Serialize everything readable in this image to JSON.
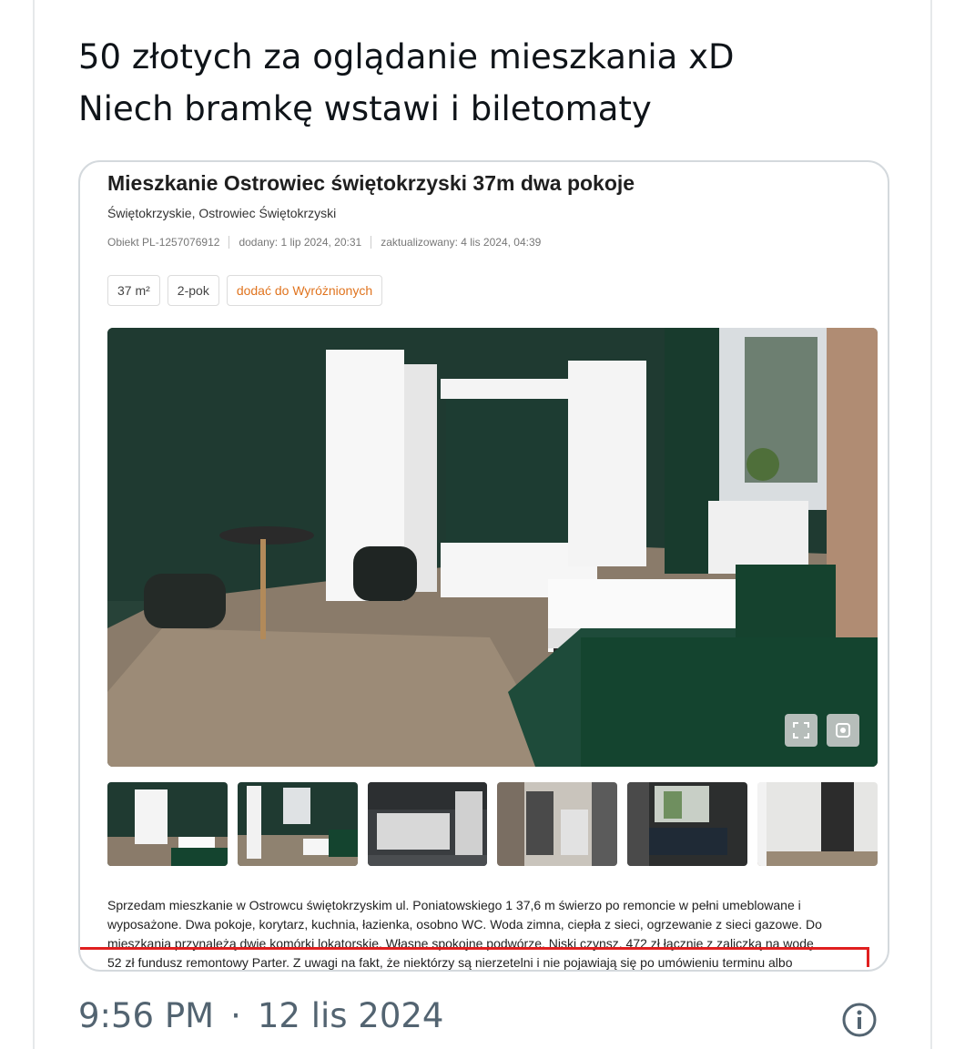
{
  "tweet": {
    "line1": "50 złotych za oglądanie mieszkania xD",
    "line2": "Niech bramkę wstawi i biletomaty"
  },
  "listing": {
    "title": "Mieszkanie Ostrowiec świętokrzyski 37m dwa pokoje",
    "location": "Świętokrzyskie, Ostrowiec Świętokrzyski",
    "object_id": "Obiekt PL-1257076912",
    "added": "dodany: 1 lip 2024, 20:31",
    "updated": "zaktualizowany: 4 lis 2024, 04:39",
    "chips": {
      "area": "37 m²",
      "rooms": "2-pok",
      "favorite": "dodać do Wyróżnionych"
    },
    "description_lines": [
      "Sprzedam mieszkanie w Ostrowcu świętokrzyskim ul. Poniatowskiego 1 37,6 m świerzo po remoncie w pełni umeblowane i",
      "wyposażone. Dwa pokoje, korytarz, kuchnia, łazienka, osobno WC. Woda zimna, ciepła z sieci, ogrzewanie z sieci gazowe. Do",
      "mieszkania przynależą dwie komórki lokatorskie. Własne spokojne podwórze. Niski czynsz. 472 zł łącznie z zaliczką na wodę",
      "52 zł fundusz remontowy Parter. Z uwagi na fakt, że niektórzy są nierzetelni i nie pojawiają się po umówieniu terminu albo"
    ],
    "icons": {
      "expand": "expand-icon",
      "fullscreen": "fullscreen-icon"
    },
    "colors": {
      "accent": "#e0741f",
      "highlight": "#e02020"
    }
  },
  "footer": {
    "time": "9:56 PM",
    "separator": "·",
    "date": "12 lis 2024",
    "icon": "info-icon"
  }
}
